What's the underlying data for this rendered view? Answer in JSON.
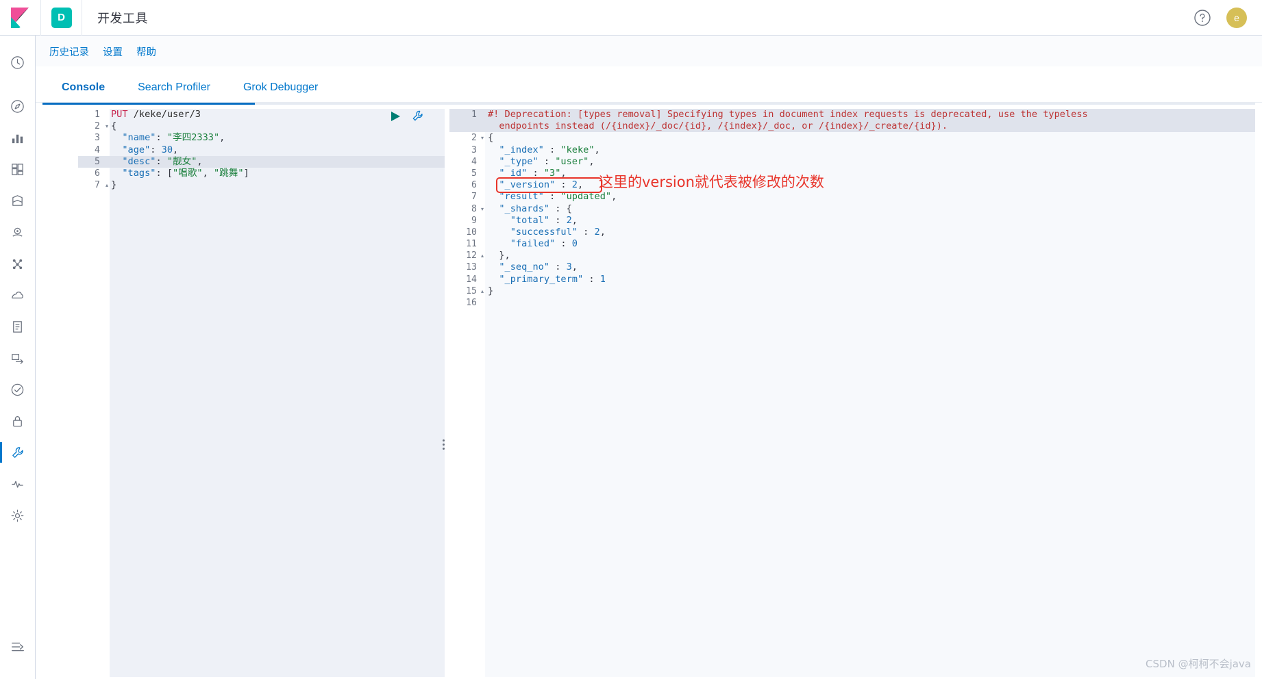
{
  "header": {
    "app_badge": "D",
    "title": "开发工具",
    "help_icon": "question-circle-icon",
    "avatar_initial": "e",
    "avatar_color": "#D6BF57",
    "badge_color": "#00BFB3"
  },
  "subnav": {
    "items": [
      {
        "label": "历史记录",
        "name": "history"
      },
      {
        "label": "设置",
        "name": "settings"
      },
      {
        "label": "帮助",
        "name": "help"
      }
    ]
  },
  "tabs": [
    {
      "label": "Console",
      "name": "console",
      "active": true
    },
    {
      "label": "Search Profiler",
      "name": "search-profiler",
      "active": false
    },
    {
      "label": "Grok Debugger",
      "name": "grok-debugger",
      "active": false
    }
  ],
  "rail": {
    "items": [
      {
        "name": "recently-viewed-icon",
        "active": false
      },
      {
        "name": "discover-icon",
        "active": false
      },
      {
        "name": "visualize-icon",
        "active": false
      },
      {
        "name": "dashboard-icon",
        "active": false
      },
      {
        "name": "canvas-icon",
        "active": false
      },
      {
        "name": "maps-icon",
        "active": false
      },
      {
        "name": "machine-learning-icon",
        "active": false
      },
      {
        "name": "infrastructure-icon",
        "active": false
      },
      {
        "name": "logs-icon",
        "active": false
      },
      {
        "name": "apm-icon",
        "active": false
      },
      {
        "name": "uptime-icon",
        "active": false
      },
      {
        "name": "security-icon",
        "active": false
      },
      {
        "name": "dev-tools-icon",
        "active": true
      },
      {
        "name": "monitoring-icon",
        "active": false
      },
      {
        "name": "management-icon",
        "active": false
      }
    ],
    "collapse": {
      "name": "collapse-nav-icon"
    }
  },
  "request": {
    "actions": {
      "play": "play-request-icon",
      "wrench": "request-options-icon"
    },
    "highlighted_line": 5,
    "lines": [
      {
        "n": "1",
        "fold": "",
        "tokens": [
          {
            "t": "PUT",
            "c": "k-method"
          },
          {
            "t": " /keke/user/3",
            "c": "k-url"
          }
        ]
      },
      {
        "n": "2",
        "fold": "▾",
        "tokens": [
          {
            "t": "{",
            "c": "k-punct"
          }
        ]
      },
      {
        "n": "3",
        "fold": "",
        "tokens": [
          {
            "t": "  \"name\"",
            "c": "k-key"
          },
          {
            "t": ": ",
            "c": "k-punct"
          },
          {
            "t": "\"李四2333\"",
            "c": "k-str"
          },
          {
            "t": ",",
            "c": "k-punct"
          }
        ]
      },
      {
        "n": "4",
        "fold": "",
        "tokens": [
          {
            "t": "  \"age\"",
            "c": "k-key"
          },
          {
            "t": ": ",
            "c": "k-punct"
          },
          {
            "t": "30",
            "c": "k-num"
          },
          {
            "t": ",",
            "c": "k-punct"
          }
        ]
      },
      {
        "n": "5",
        "fold": "",
        "tokens": [
          {
            "t": "  \"desc\"",
            "c": "k-key"
          },
          {
            "t": ": ",
            "c": "k-punct"
          },
          {
            "t": "\"靓女\"",
            "c": "k-str"
          },
          {
            "t": ",",
            "c": "k-punct"
          }
        ]
      },
      {
        "n": "6",
        "fold": "",
        "tokens": [
          {
            "t": "  \"tags\"",
            "c": "k-key"
          },
          {
            "t": ": [",
            "c": "k-punct"
          },
          {
            "t": "\"唱歌\"",
            "c": "k-str"
          },
          {
            "t": ", ",
            "c": "k-punct"
          },
          {
            "t": "\"跳舞\"",
            "c": "k-str"
          },
          {
            "t": "]",
            "c": "k-punct"
          }
        ]
      },
      {
        "n": "7",
        "fold": "▴",
        "tokens": [
          {
            "t": "}",
            "c": "k-punct"
          }
        ]
      }
    ]
  },
  "response": {
    "deprecation_line_1": "#! Deprecation: [types removal] Specifying types in document index requests is deprecated, use the typeless",
    "deprecation_line_2": "endpoints instead (/{index}/_doc/{id}, /{index}/_doc, or /{index}/_create/{id}).",
    "lines": [
      {
        "n": "2",
        "fold": "▾",
        "tokens": [
          {
            "t": "{",
            "c": "k-punct"
          }
        ]
      },
      {
        "n": "3",
        "fold": "",
        "tokens": [
          {
            "t": "  \"_index\"",
            "c": "k-key"
          },
          {
            "t": " : ",
            "c": "k-punct"
          },
          {
            "t": "\"keke\"",
            "c": "k-str"
          },
          {
            "t": ",",
            "c": "k-punct"
          }
        ]
      },
      {
        "n": "4",
        "fold": "",
        "tokens": [
          {
            "t": "  \"_type\"",
            "c": "k-key"
          },
          {
            "t": " : ",
            "c": "k-punct"
          },
          {
            "t": "\"user\"",
            "c": "k-str"
          },
          {
            "t": ",",
            "c": "k-punct"
          }
        ]
      },
      {
        "n": "5",
        "fold": "",
        "tokens": [
          {
            "t": "  \"_id\"",
            "c": "k-key"
          },
          {
            "t": " : ",
            "c": "k-punct"
          },
          {
            "t": "\"3\"",
            "c": "k-str"
          },
          {
            "t": ",",
            "c": "k-punct"
          }
        ]
      },
      {
        "n": "6",
        "fold": "",
        "tokens": [
          {
            "t": "  \"_version\"",
            "c": "k-key"
          },
          {
            "t": " : ",
            "c": "k-punct"
          },
          {
            "t": "2",
            "c": "k-num"
          },
          {
            "t": ",",
            "c": "k-punct"
          }
        ]
      },
      {
        "n": "7",
        "fold": "",
        "tokens": [
          {
            "t": "  \"result\"",
            "c": "k-key"
          },
          {
            "t": " : ",
            "c": "k-punct"
          },
          {
            "t": "\"updated\"",
            "c": "k-str"
          },
          {
            "t": ",",
            "c": "k-punct"
          }
        ]
      },
      {
        "n": "8",
        "fold": "▾",
        "tokens": [
          {
            "t": "  \"_shards\"",
            "c": "k-key"
          },
          {
            "t": " : {",
            "c": "k-punct"
          }
        ]
      },
      {
        "n": "9",
        "fold": "",
        "tokens": [
          {
            "t": "    \"total\"",
            "c": "k-key"
          },
          {
            "t": " : ",
            "c": "k-punct"
          },
          {
            "t": "2",
            "c": "k-num"
          },
          {
            "t": ",",
            "c": "k-punct"
          }
        ]
      },
      {
        "n": "10",
        "fold": "",
        "tokens": [
          {
            "t": "    \"successful\"",
            "c": "k-key"
          },
          {
            "t": " : ",
            "c": "k-punct"
          },
          {
            "t": "2",
            "c": "k-num"
          },
          {
            "t": ",",
            "c": "k-punct"
          }
        ]
      },
      {
        "n": "11",
        "fold": "",
        "tokens": [
          {
            "t": "    \"failed\"",
            "c": "k-key"
          },
          {
            "t": " : ",
            "c": "k-punct"
          },
          {
            "t": "0",
            "c": "k-num"
          }
        ]
      },
      {
        "n": "12",
        "fold": "▴",
        "tokens": [
          {
            "t": "  },",
            "c": "k-punct"
          }
        ]
      },
      {
        "n": "13",
        "fold": "",
        "tokens": [
          {
            "t": "  \"_seq_no\"",
            "c": "k-key"
          },
          {
            "t": " : ",
            "c": "k-punct"
          },
          {
            "t": "3",
            "c": "k-num"
          },
          {
            "t": ",",
            "c": "k-punct"
          }
        ]
      },
      {
        "n": "14",
        "fold": "",
        "tokens": [
          {
            "t": "  \"_primary_term\"",
            "c": "k-key"
          },
          {
            "t": " : ",
            "c": "k-punct"
          },
          {
            "t": "1",
            "c": "k-num"
          }
        ]
      },
      {
        "n": "15",
        "fold": "▴",
        "tokens": [
          {
            "t": "}",
            "c": "k-punct"
          }
        ]
      },
      {
        "n": "16",
        "fold": "",
        "tokens": [
          {
            "t": "",
            "c": "k-punct"
          }
        ]
      }
    ]
  },
  "annotation": {
    "text": "这里的version就代表被修改的次数",
    "color": "#e8342a",
    "highlight_box_color": "#e8342a"
  },
  "watermark": "CSDN @柯柯不会java"
}
